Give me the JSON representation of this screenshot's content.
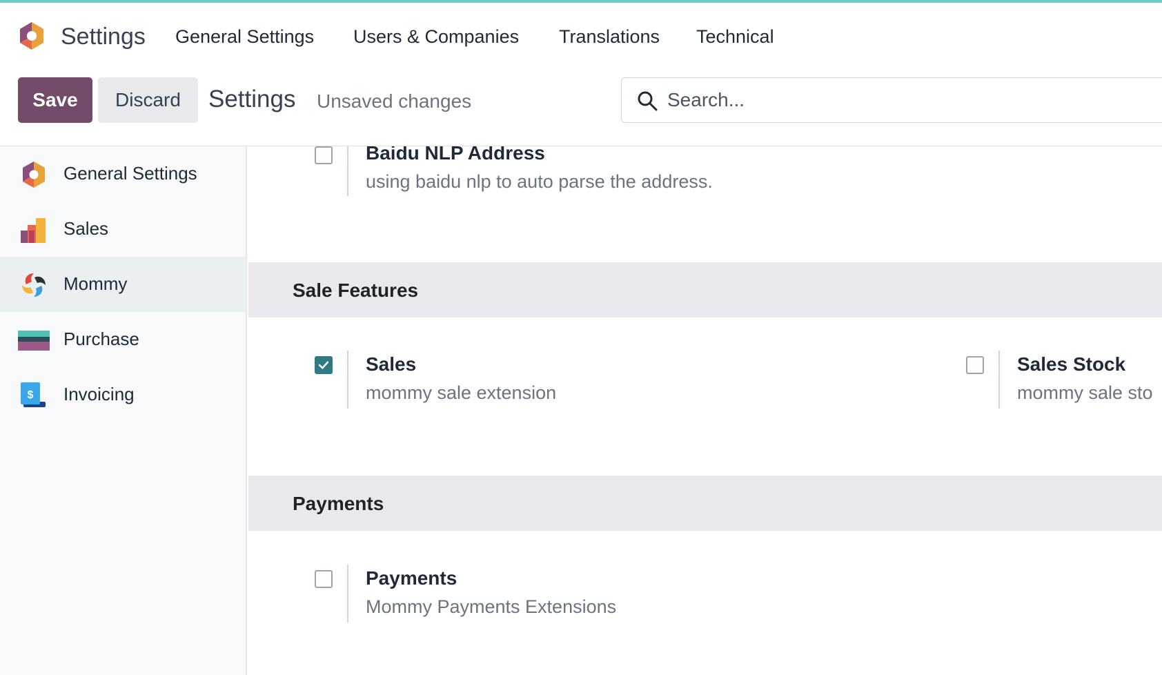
{
  "navbar": {
    "app_name": "Settings",
    "items": [
      "General Settings",
      "Users & Companies",
      "Translations",
      "Technical"
    ]
  },
  "control_panel": {
    "save_label": "Save",
    "discard_label": "Discard",
    "breadcrumb": "Settings",
    "status": "Unsaved changes",
    "search_placeholder": "Search..."
  },
  "sidebar": {
    "items": [
      {
        "label": "General Settings",
        "icon": "settings-app-icon",
        "active": false
      },
      {
        "label": "Sales",
        "icon": "sales-app-icon",
        "active": false
      },
      {
        "label": "Mommy",
        "icon": "mommy-app-icon",
        "active": true
      },
      {
        "label": "Purchase",
        "icon": "purchase-app-icon",
        "active": false
      },
      {
        "label": "Invoicing",
        "icon": "invoicing-app-icon",
        "active": false
      }
    ]
  },
  "main": {
    "top_setting": {
      "title": "Baidu NLP Address",
      "description": "using baidu nlp to auto parse the address.",
      "checked": false
    },
    "sections": [
      {
        "title": "Sale Features",
        "settings": [
          {
            "title": "Sales",
            "description": "mommy sale extension",
            "checked": true
          },
          {
            "title": "Sales Stock",
            "description": "mommy sale sto",
            "checked": false
          }
        ]
      },
      {
        "title": "Payments",
        "settings": [
          {
            "title": "Payments",
            "description": "Mommy Payments Extensions",
            "checked": false
          }
        ]
      }
    ]
  },
  "colors": {
    "brand": "#714b67",
    "checkbox_checked": "#2e7c81",
    "section_bg": "#e7e9ed",
    "sidebar_active_bg": "#eaeff1"
  }
}
